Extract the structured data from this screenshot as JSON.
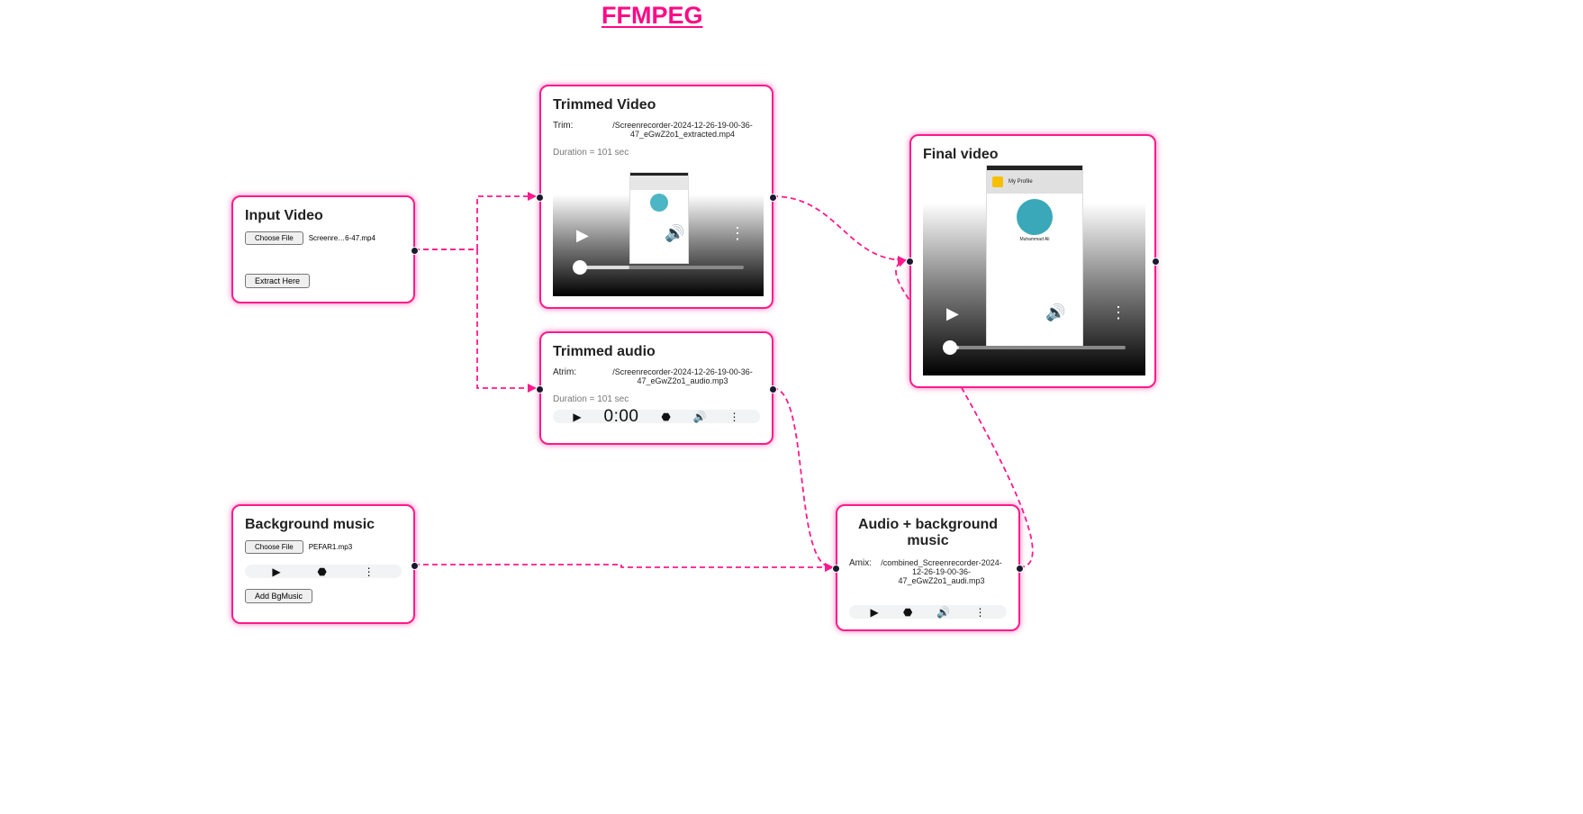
{
  "app": {
    "title": "FFMPEG"
  },
  "input_video": {
    "title": "Input Video",
    "choose_label": "Choose File",
    "file_name": "Screenre…6-47.mp4",
    "extract_label": "Extract Here"
  },
  "trimmed_video": {
    "title": "Trimmed Video",
    "trim_label": "Trim:",
    "path": "/Screenrecorder-2024-12-26-19-00-36-47_eGwZ2o1_extracted.mp4",
    "duration": "Duration = 101 sec",
    "progress": 0.3
  },
  "trimmed_audio": {
    "title": "Trimmed audio",
    "atrim_label": "Atrim:",
    "path": "/Screenrecorder-2024-12-26-19-00-36-47_eGwZ2o1_audio.mp3",
    "duration": "Duration = 101 sec",
    "time": "0:00"
  },
  "background_music": {
    "title": "Background music",
    "choose_label": "Choose File",
    "file_name": "PEFAR1.mp3",
    "add_label": "Add BgMusic"
  },
  "final_video": {
    "title": "Final video",
    "app_bar": "My Profile",
    "user_name": "Muhammad Ali",
    "progress": 0.05
  },
  "audio_bg": {
    "title": "Audio + background music",
    "amix_label": "Amix:",
    "path": "/combined_Screenrecorder-2024-12-26-19-00-36-47_eGwZ2o1_audi.mp3"
  },
  "colors": {
    "accent": "#ff0a84",
    "handle": "#1a1a2e",
    "edge": "#ff1a8c"
  },
  "icons": [
    "play-icon",
    "volume-icon",
    "more-vert-icon",
    "file-icon"
  ]
}
